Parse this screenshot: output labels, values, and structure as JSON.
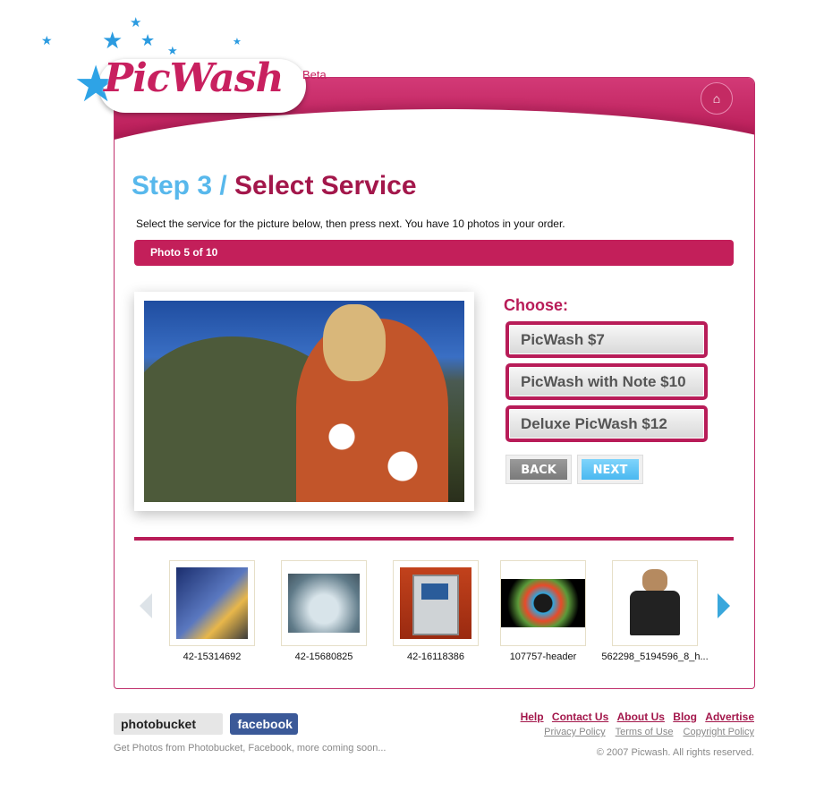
{
  "brand": {
    "name": "PicWash",
    "tag": "Beta",
    "colors": {
      "primary": "#c31f5a",
      "accent": "#58b8ec"
    }
  },
  "header": {
    "home_icon": "home-icon"
  },
  "step": {
    "number": "Step 3 /",
    "title": "Select Service"
  },
  "intro": "Select the service for the picture below, then press next. You have 10 photos in your order.",
  "progress": "Photo 5 of 10",
  "choose_label": "Choose:",
  "services": [
    "PicWash $7",
    "PicWash with Note $10",
    "Deluxe PicWash $12"
  ],
  "buttons": {
    "back": "BACK",
    "next": "NEXT"
  },
  "thumbnails": [
    {
      "caption": "42-15314692"
    },
    {
      "caption": "42-15680825"
    },
    {
      "caption": "42-16118386"
    },
    {
      "caption": "107757-header"
    },
    {
      "caption": "562298_5194596_8_h..."
    }
  ],
  "footer": {
    "sources": [
      "photobucket",
      "facebook"
    ],
    "note": "Get Photos from Photobucket, Facebook, more coming soon...",
    "links": [
      "Help",
      "Contact Us",
      "About Us",
      "Blog",
      "Advertise"
    ],
    "legal_links": [
      "Privacy Policy",
      "Terms of Use",
      "Copyright Policy"
    ],
    "copyright": "© 2007 Picwash. All rights reserved."
  }
}
